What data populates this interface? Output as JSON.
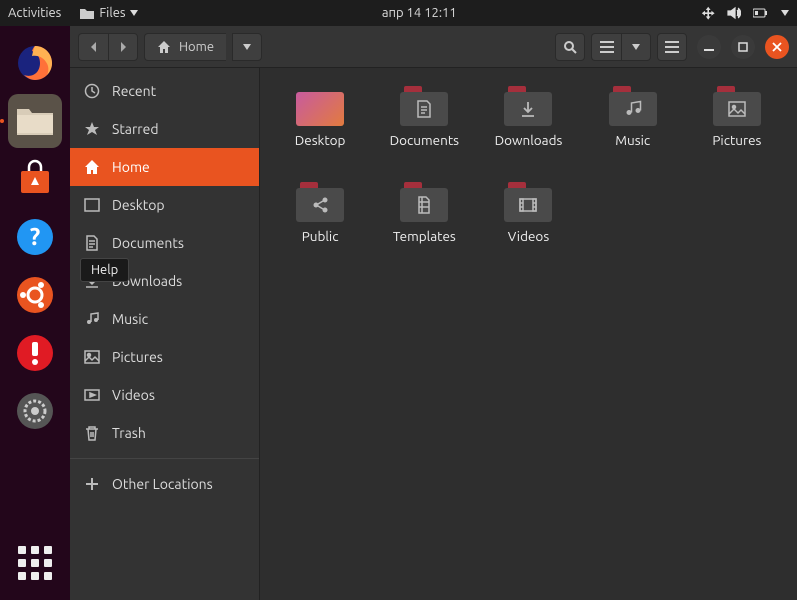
{
  "panel": {
    "activities": "Activities",
    "app_menu": "Files",
    "clock": "апр 14  12:11"
  },
  "tooltip": "Help",
  "titlebar": {
    "location": "Home"
  },
  "sidebar": {
    "items": [
      {
        "label": "Recent"
      },
      {
        "label": "Starred"
      },
      {
        "label": "Home"
      },
      {
        "label": "Desktop"
      },
      {
        "label": "Documents"
      },
      {
        "label": "Downloads"
      },
      {
        "label": "Music"
      },
      {
        "label": "Pictures"
      },
      {
        "label": "Videos"
      },
      {
        "label": "Trash"
      }
    ],
    "other": "Other Locations"
  },
  "folders": [
    {
      "name": "Desktop"
    },
    {
      "name": "Documents"
    },
    {
      "name": "Downloads"
    },
    {
      "name": "Music"
    },
    {
      "name": "Pictures"
    },
    {
      "name": "Public"
    },
    {
      "name": "Templates"
    },
    {
      "name": "Videos"
    }
  ]
}
